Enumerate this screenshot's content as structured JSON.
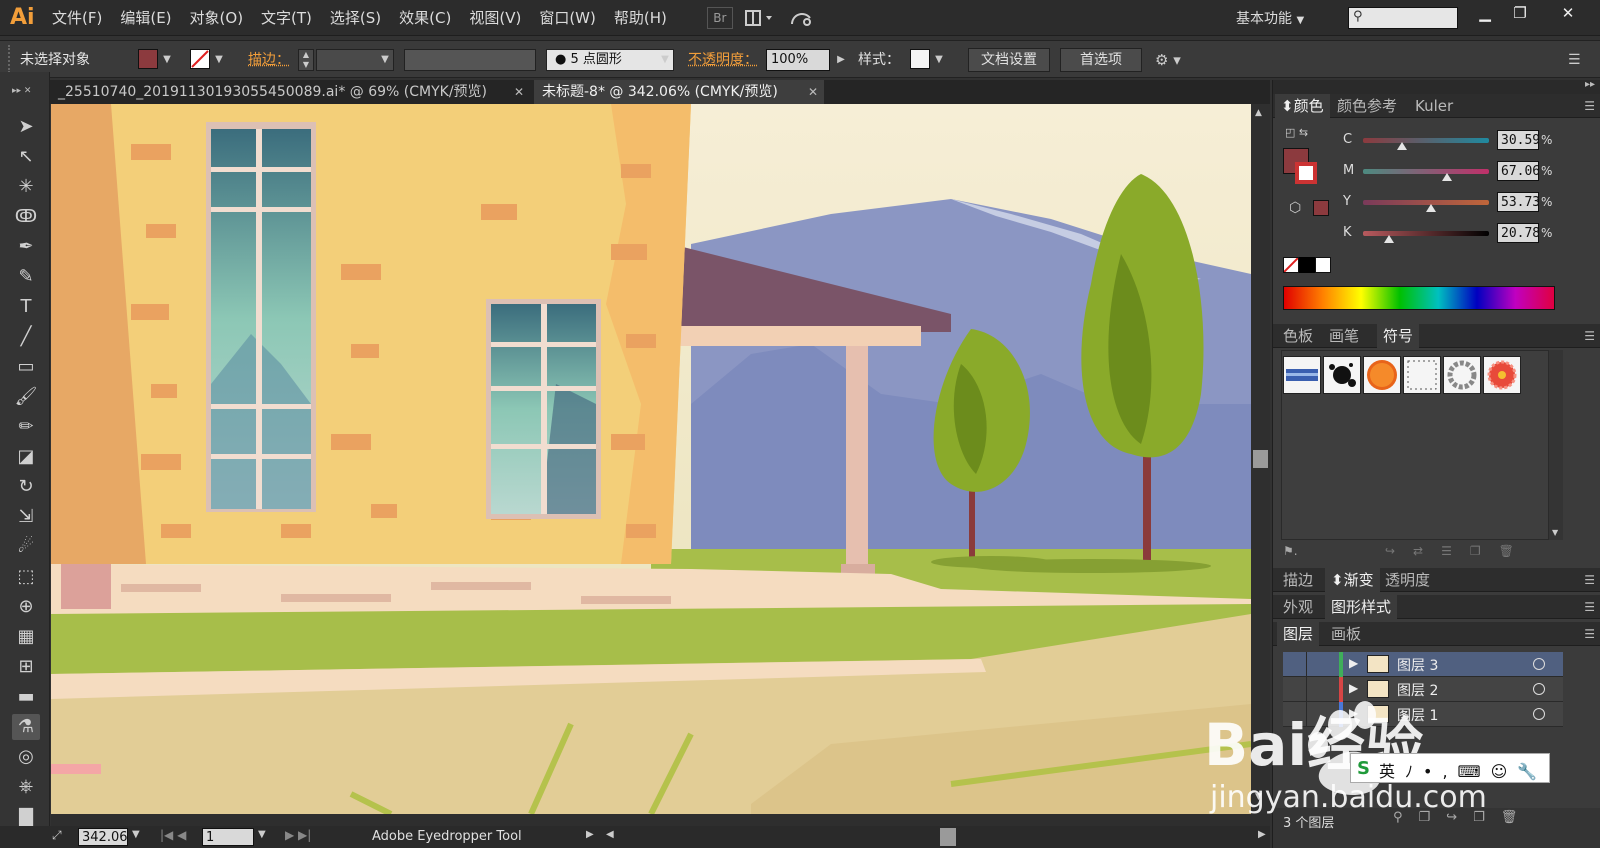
{
  "app": {
    "logo": "Ai"
  },
  "menu": [
    "文件(F)",
    "编辑(E)",
    "对象(O)",
    "文字(T)",
    "选择(S)",
    "效果(C)",
    "视图(V)",
    "窗口(W)",
    "帮助(H)"
  ],
  "menubar": {
    "bridge_label": "Br",
    "workspace": "基本功能"
  },
  "control_bar": {
    "selection_status": "未选择对象",
    "stroke_label": "描边：",
    "brush_label": "5 点圆形",
    "opacity_label": "不透明度：",
    "opacity_value": "100%",
    "style_label": "样式：",
    "doc_setup_button": "文档设置",
    "prefs_button": "首选项",
    "fill_color": "#8c3a3e"
  },
  "tabs": [
    {
      "label": "_25510740_20191130193055450089.ai* @ 69% (CMYK/预览)",
      "active": false
    },
    {
      "label": "未标题-8* @ 342.06% (CMYK/预览)",
      "active": true
    }
  ],
  "status_bar": {
    "zoom": "342.06",
    "page": "1",
    "tool_name": "Adobe Eyedropper Tool"
  },
  "color_panel": {
    "tabs": [
      "颜色",
      "颜色参考",
      "Kuler"
    ],
    "channels": [
      {
        "name": "C",
        "value": "30.59",
        "fraction": 0.3059
      },
      {
        "name": "M",
        "value": "67.06",
        "fraction": 0.6706
      },
      {
        "name": "Y",
        "value": "53.73",
        "fraction": 0.5373
      },
      {
        "name": "K",
        "value": "20.78",
        "fraction": 0.2078
      }
    ],
    "percent": "%",
    "fill_color": "#8c3a3e"
  },
  "swatch_panel": {
    "tabs": [
      "色板",
      "画笔",
      "符号"
    ]
  },
  "appearance_panel": {
    "tabs": [
      "描边",
      "渐变",
      "透明度"
    ]
  },
  "style_panel": {
    "tabs": [
      "外观",
      "图形样式"
    ]
  },
  "layers_panel": {
    "tabs": [
      "图层",
      "画板"
    ],
    "layers": [
      {
        "name": "图层 3",
        "selected": true,
        "color": "#3fae5a"
      },
      {
        "name": "图层 2",
        "selected": false,
        "color": "#d64545"
      },
      {
        "name": "图层 1",
        "selected": false,
        "color": "#4a78d8"
      }
    ],
    "count_label": "3 个图层"
  },
  "watermark": {
    "text": "Bai经验",
    "url": "jingyan.baidu.com"
  }
}
